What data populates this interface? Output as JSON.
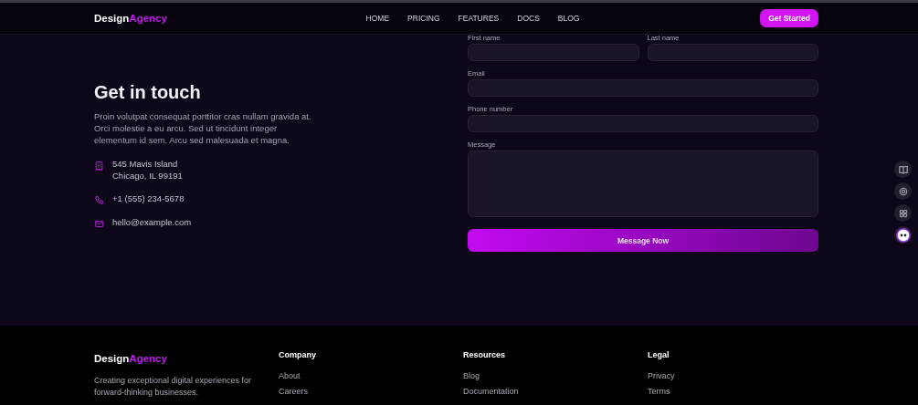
{
  "header": {
    "logo": {
      "first": "Design",
      "second": "Agency"
    },
    "nav": [
      "HOME",
      "PRICING",
      "FEATURES",
      "DOCS",
      "BLOG"
    ],
    "cta": "Get Started"
  },
  "contact": {
    "title": "Get in touch",
    "text": "Proin volutpat consequat porttitor cras nullam gravida at. Orci molestie a eu arcu. Sed ut tincidunt integer elementum id sem. Arcu sed malesuada et magna.",
    "items": [
      {
        "kind": "address",
        "lines": [
          "545 Mavis Island",
          "Chicago, IL 99191"
        ]
      },
      {
        "kind": "phone",
        "lines": [
          "+1 (555) 234-5678"
        ]
      },
      {
        "kind": "email",
        "lines": [
          "hello@example.com"
        ]
      }
    ]
  },
  "form": {
    "fields": [
      {
        "label": "First name",
        "kind": "input"
      },
      {
        "label": "Last name",
        "kind": "input"
      },
      {
        "label": "Email",
        "kind": "input"
      },
      {
        "label": "Phone number",
        "kind": "input"
      },
      {
        "label": "Message",
        "kind": "textarea"
      }
    ],
    "submit": "Message Now"
  },
  "footer": {
    "logo": {
      "first": "Design",
      "second": "Agency"
    },
    "tagline": "Creating exceptional digital experiences for forward-thinking businesses.",
    "columns": [
      {
        "title": "Company",
        "links": [
          "About",
          "Careers"
        ]
      },
      {
        "title": "Resources",
        "links": [
          "Blog",
          "Documentation"
        ]
      },
      {
        "title": "Legal",
        "links": [
          "Privacy",
          "Terms"
        ]
      }
    ]
  }
}
